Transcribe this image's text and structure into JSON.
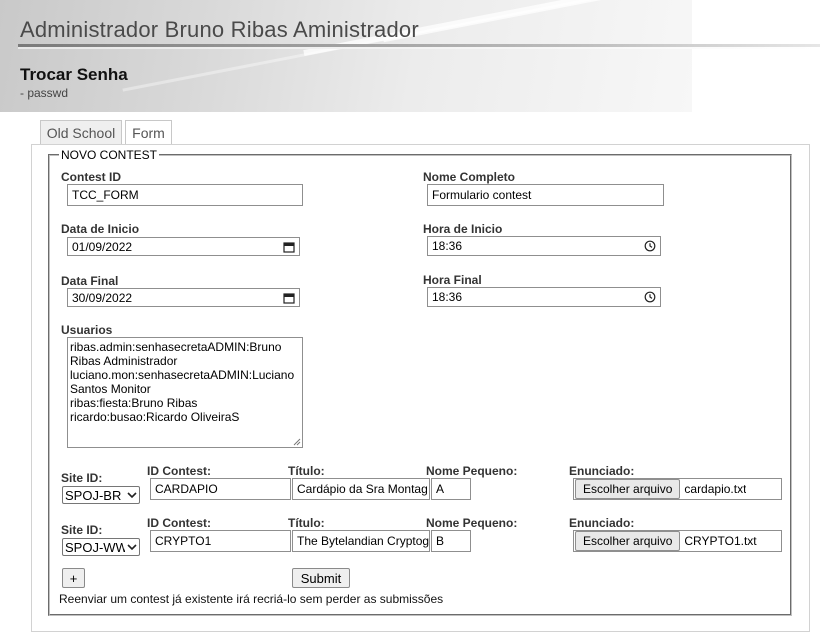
{
  "header": {
    "site_title": "Administrador Bruno Ribas Aministrador",
    "page_title": "Trocar Senha",
    "page_subtitle": "- passwd"
  },
  "tabs": [
    {
      "label": "Old School",
      "active": false
    },
    {
      "label": "Form",
      "active": true
    }
  ],
  "form": {
    "legend": "NOVO CONTEST",
    "contest_id": {
      "label": "Contest ID",
      "value": "TCC_FORM"
    },
    "nome_completo": {
      "label": "Nome Completo",
      "value": "Formulario contest"
    },
    "data_inicio": {
      "label": "Data de Inicio",
      "value": "01/09/2022"
    },
    "hora_inicio": {
      "label": "Hora de Inicio",
      "value": "18:36"
    },
    "data_final": {
      "label": "Data Final",
      "value": "30/09/2022"
    },
    "hora_final": {
      "label": "Hora Final",
      "value": "18:36"
    },
    "usuarios": {
      "label": "Usuarios",
      "lines": [
        "ribas.admin:senhasecretaADMIN:Bruno",
        "Ribas Administrador",
        "luciano.mon:senhasecretaADMIN:Luciano",
        "Santos Monitor",
        "ribas:fiesta:Bruno Ribas",
        "ricardo:busao:Ricardo OliveiraS"
      ]
    },
    "problem_labels": {
      "site_id": "Site ID:",
      "id_contest": "ID Contest:",
      "titulo": "Título:",
      "nome_pequeno": "Nome Pequeno:",
      "enunciado": "Enunciado:"
    },
    "problems": [
      {
        "site_id": "SPOJ-BR",
        "id_contest": "CARDAPIO",
        "titulo": "Cardápio da Sra Montag",
        "nome_pequeno": "A",
        "file_button": "Escolher arquivo",
        "file_name": "cardapio.txt"
      },
      {
        "site_id": "SPOJ-WW",
        "id_contest": "CRYPTO1",
        "titulo": "The Bytelandian Cryptog",
        "nome_pequeno": "B",
        "file_button": "Escolher arquivo",
        "file_name": "CRYPTO1.txt"
      }
    ],
    "add_button": "+",
    "submit_button": "Submit",
    "note": "Reenviar um contest já existente irá recriá-lo sem perder as submissões"
  },
  "icons": {
    "calendar": "calendar-icon",
    "clock": "clock-icon",
    "dropdown": "chevron-down-icon"
  }
}
